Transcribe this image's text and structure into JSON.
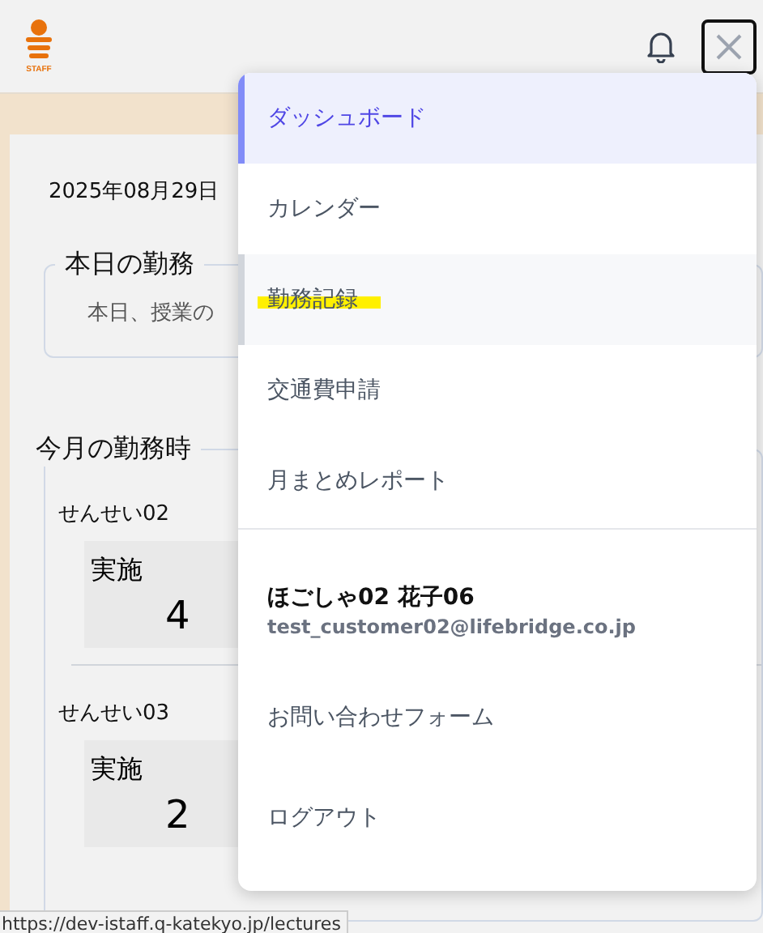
{
  "header": {
    "logo_text": "STAFF"
  },
  "page": {
    "date": "2025年08月29日",
    "today": {
      "title": "本日の勤務",
      "text": "本日、授業の"
    },
    "month": {
      "title": "今月の勤務時",
      "teachers": [
        {
          "name": "せんせい02",
          "stat_label": "実施",
          "stat_value": "4"
        },
        {
          "name": "せんせい03",
          "stat_label": "実施",
          "stat_value": "2"
        }
      ]
    }
  },
  "menu": {
    "items": [
      {
        "label": "ダッシュボード",
        "selected": true,
        "hovered": false,
        "highlighted": false
      },
      {
        "label": "カレンダー",
        "selected": false,
        "hovered": false,
        "highlighted": false
      },
      {
        "label": "勤務記録",
        "selected": false,
        "hovered": true,
        "highlighted": true
      },
      {
        "label": "交通費申請",
        "selected": false,
        "hovered": false,
        "highlighted": false
      },
      {
        "label": "月まとめレポート",
        "selected": false,
        "hovered": false,
        "highlighted": false
      }
    ],
    "user": {
      "name": "ほごしゃ02 花子06",
      "email": "test_customer02@lifebridge.co.jp"
    },
    "footer_items": [
      "お問い合わせフォーム",
      "ログアウト"
    ]
  },
  "status_bar": {
    "url": "https://dev-istaff.q-katekyo.jp/lectures"
  }
}
